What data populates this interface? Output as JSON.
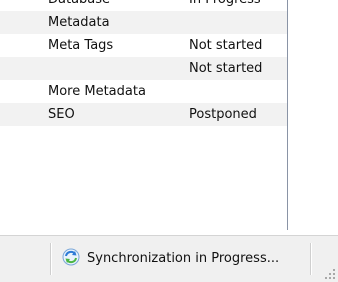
{
  "rows": [
    {
      "name": "Database",
      "status": "In Progress"
    },
    {
      "name": "Metadata",
      "status": ""
    },
    {
      "name": "Meta Tags",
      "status": "Not started"
    },
    {
      "name": "",
      "status": "Not started"
    },
    {
      "name": "More Metadata",
      "status": ""
    },
    {
      "name": "SEO",
      "status": "Postponed"
    }
  ],
  "statusbar": {
    "text": "Synchronization in Progress...",
    "icon": "sync-icon"
  },
  "colors": {
    "alt_row": "#f2f2f2",
    "statusbar_bg": "#f0f0f0",
    "panel_border": "#8a94a6",
    "icon_blue": "#2e7bd6",
    "icon_green": "#4bb543"
  }
}
